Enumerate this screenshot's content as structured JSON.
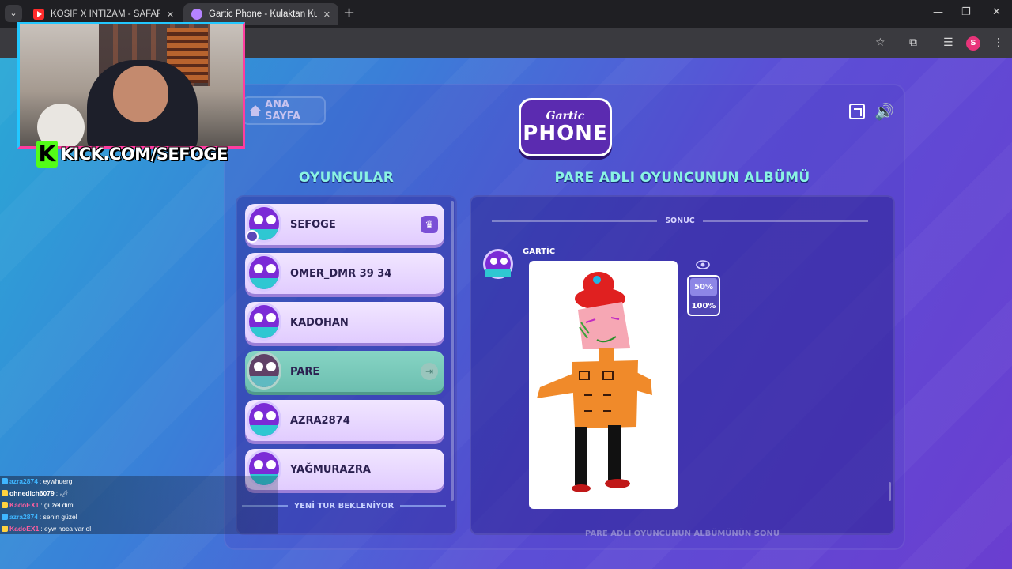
{
  "browser": {
    "tabs": [
      {
        "title": "KOSİF X İNTİZAM - SAFARİ ( O",
        "active": false,
        "favicon": "youtube-icon"
      },
      {
        "title": "Gartic Phone - Kulaktan Kulağa",
        "active": true,
        "favicon": "gartic-icon"
      }
    ],
    "new_tab": "+",
    "profile_initial": "S"
  },
  "game": {
    "home_button": "ANA SAYFA",
    "logo_top": "Gartic",
    "logo_bottom": "PHONE",
    "players_title": "OYUNCULAR",
    "album_title": "PARE ADLI OYUNCUNUN ALBÜMÜ",
    "players": [
      {
        "name": "SEFOGE",
        "status": "host"
      },
      {
        "name": "OMER_DMR 39 34",
        "status": ""
      },
      {
        "name": "KADOHAN",
        "status": ""
      },
      {
        "name": "PARE",
        "status": "left"
      },
      {
        "name": "AZRA2874",
        "status": ""
      },
      {
        "name": "YAĞMURAZRA",
        "status": ""
      }
    ],
    "waiting_label": "YENİ TUR BEKLENİYOR",
    "result_label": "SONUÇ",
    "entry_author": "GARTİC",
    "zoom_options": [
      "50%",
      "100%"
    ],
    "zoom_selected": "50%",
    "album_end": "PARE ADLI OYUNCUNUN ALBÜMÜNÜN SONU"
  },
  "overlay": {
    "kick_logo": "K",
    "kick_url": "KICK.COM/SEFOGE",
    "chat": [
      {
        "user": "azra2874",
        "message": ": eywhuerg",
        "color": "#3fb6ff"
      },
      {
        "user": "ohnedich6079",
        "message": ": 🌶",
        "color": "#ffffff"
      },
      {
        "user": "KadoEX1",
        "message": ": güzel dimi",
        "color": "#ff5fa0"
      },
      {
        "user": "azra2874",
        "message": ": senin güzel",
        "color": "#3fb6ff"
      },
      {
        "user": "KadoEX1",
        "message": ": eyw hoca var ol",
        "color": "#ff5fa0"
      }
    ]
  }
}
